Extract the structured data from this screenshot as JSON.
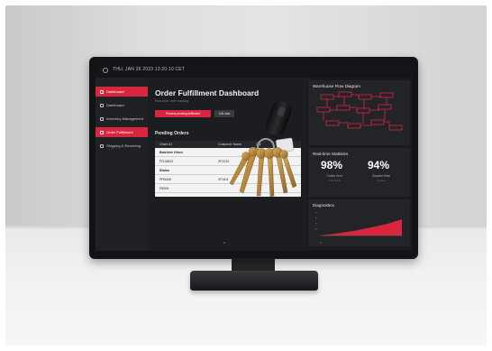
{
  "topbar": {
    "datetime": "THU, JAN 26 2023 13:20:10 CET"
  },
  "sidebar": {
    "items": [
      {
        "label": "Dashboard",
        "active": true
      },
      {
        "label": "Dashboard",
        "active": false
      },
      {
        "label": "Inventory Management",
        "active": false
      },
      {
        "label": "Order Fulfillment",
        "active": true
      },
      {
        "label": "Shipping & Receiving",
        "active": false
      }
    ]
  },
  "main": {
    "title": "Order Fulfillment Dashboard",
    "subtitle": "Real-time order tracking",
    "primary_button": "Process pending fulfillment",
    "secondary_button": "Edit data",
    "pending_title": "Pending Orders",
    "table": {
      "headers": [
        "Order ID",
        "Customer Name",
        "Qty",
        "Due Date"
      ],
      "rows": [
        [
          "Batchine Hines",
          "",
          "",
          ""
        ],
        [
          "PO18523",
          "2F2220",
          "",
          ""
        ],
        [
          "Status",
          "",
          "",
          ""
        ],
        [
          "PR5406",
          "2F18:8",
          "",
          ""
        ],
        [
          "P8506",
          "",
          "",
          ""
        ]
      ]
    }
  },
  "right": {
    "flow_title": "Warehouse Flow Diagram",
    "stats_title": "Real-time Statistics",
    "stats": [
      {
        "value": "98%",
        "label": "Orders Sent",
        "sub": "order sent"
      },
      {
        "value": "94%",
        "label": "Dispatch Rate",
        "sub": "on time"
      }
    ],
    "diagnostics_title": "Diagnostics"
  },
  "colors": {
    "accent": "#d7263d",
    "screen_bg": "#1c1d21",
    "panel_bg": "#232428"
  }
}
